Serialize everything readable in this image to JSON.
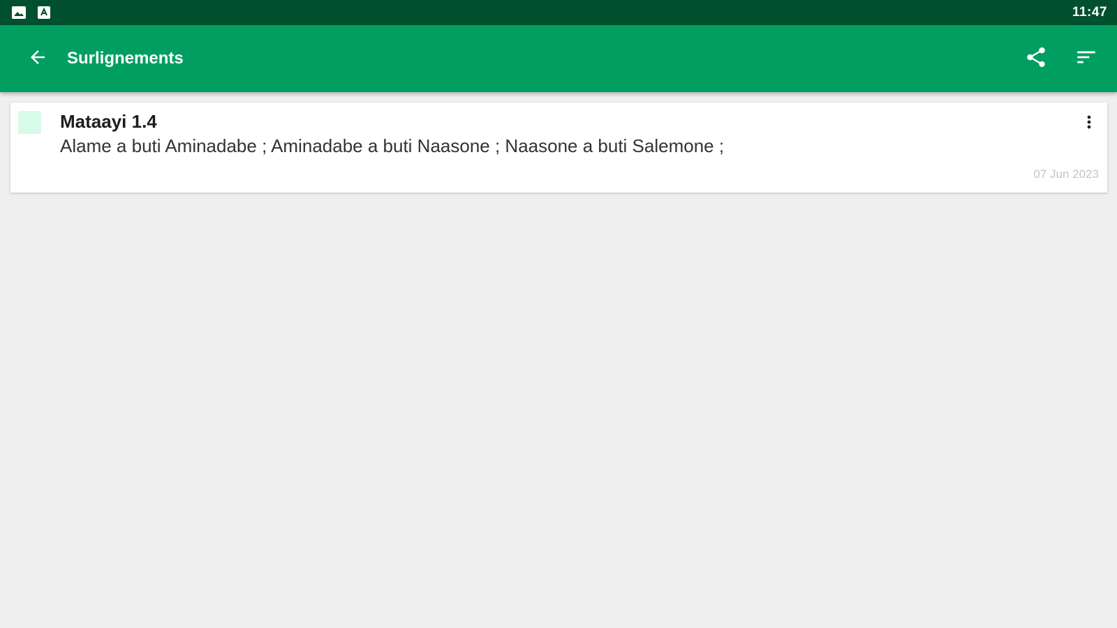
{
  "status_bar": {
    "icons": [
      "image-icon",
      "app-notification-icon"
    ],
    "time": "11:47"
  },
  "app_bar": {
    "back_icon": "arrow-back-icon",
    "title": "Surlignements",
    "actions": [
      "share-icon",
      "sort-icon"
    ]
  },
  "highlights": [
    {
      "color": "#d8fbe9",
      "reference": "Mataayi 1.4",
      "text": "Alame a buti Aminadabe ; Aminadabe a buti Naasone ; Naasone a buti Salemone ;",
      "date": "07 Jun 2023",
      "menu_icon": "more-vert-icon"
    }
  ],
  "colors": {
    "status_bar": "#00502e",
    "app_bar": "#009e5f",
    "background": "#efefef",
    "card": "#ffffff"
  }
}
